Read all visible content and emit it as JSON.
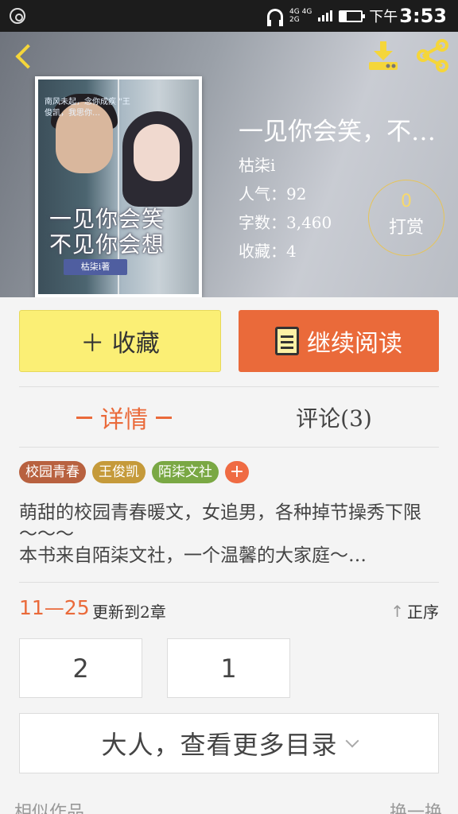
{
  "status_bar": {
    "network": "4G 4G\n2G",
    "time_prefix": "下午",
    "time": "3:53"
  },
  "header": {
    "back_icon": "chevron-left-icon",
    "download_icon": "download-icon",
    "share_icon": "share-icon",
    "accent": "#f5d63a"
  },
  "cover": {
    "blurb": "南风未起，念你成疾 \"王俊凯，我思你…",
    "title_line1": "一见你会笑",
    "title_line2": "不见你会想",
    "author_badge": "枯柒i著"
  },
  "book": {
    "title": "一见你会笑，不…",
    "author": "枯柒i",
    "popularity": "人气：92",
    "word_count": "字数：3,460",
    "favorites": "收藏：4"
  },
  "tip": {
    "count": "0",
    "label": "打赏"
  },
  "actions": {
    "favorite": "＋ 收藏",
    "continue_reading": "继续阅读"
  },
  "tabs": {
    "detail": "详情",
    "comments": "评论(3)"
  },
  "tags": [
    {
      "label": "校园青春",
      "color": "#b8613f"
    },
    {
      "label": "王俊凯",
      "color": "#c59a3a"
    },
    {
      "label": "陌柒文社",
      "color": "#7aa844"
    }
  ],
  "tag_add": "+",
  "description": "萌甜的校园青春暖文，女追男，各种掉节操秀下限～～～\n本书来自陌柒文社，一个温馨的大家庭～…",
  "update": {
    "date": "11—25",
    "text": "更新到2章",
    "sort": "正序"
  },
  "chapters": [
    "2",
    "1"
  ],
  "more_catalog": "大人，查看更多目录",
  "similar": {
    "title": "相似作品",
    "more": "换一换"
  },
  "colors": {
    "primary": "#ea6a3a",
    "favorite_bg": "#fbef75"
  }
}
